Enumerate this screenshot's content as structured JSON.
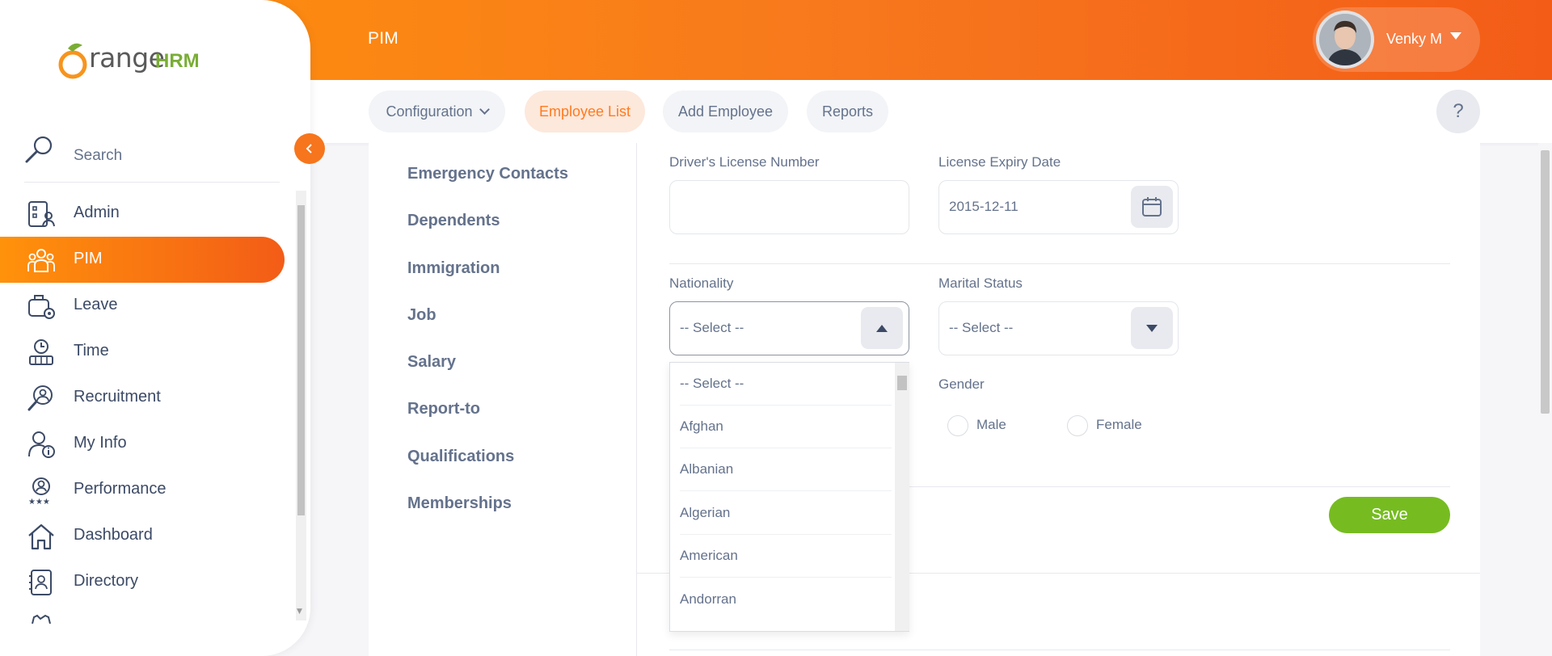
{
  "app": {
    "brand_text": "range",
    "brand_hrm": "HRM",
    "module_title": "PIM"
  },
  "user": {
    "name": "Venky M"
  },
  "subnav": {
    "configuration": "Configuration",
    "employee_list": "Employee List",
    "add_employee": "Add Employee",
    "reports": "Reports",
    "help": "?"
  },
  "sidebar": {
    "search_label": "Search",
    "items": [
      {
        "label": "Admin",
        "icon": "admin-icon"
      },
      {
        "label": "PIM",
        "icon": "pim-icon",
        "active": true
      },
      {
        "label": "Leave",
        "icon": "leave-icon"
      },
      {
        "label": "Time",
        "icon": "time-icon"
      },
      {
        "label": "Recruitment",
        "icon": "recruitment-icon"
      },
      {
        "label": "My Info",
        "icon": "my-info-icon"
      },
      {
        "label": "Performance",
        "icon": "performance-icon"
      },
      {
        "label": "Dashboard",
        "icon": "dashboard-icon"
      },
      {
        "label": "Directory",
        "icon": "directory-icon"
      }
    ]
  },
  "tabs": [
    "Emergency Contacts",
    "Dependents",
    "Immigration",
    "Job",
    "Salary",
    "Report-to",
    "Qualifications",
    "Memberships"
  ],
  "form": {
    "drivers_license_label": "Driver's License Number",
    "drivers_license_value": "",
    "license_expiry_label": "License Expiry Date",
    "license_expiry_value": "2015-12-11",
    "nationality_label": "Nationality",
    "nationality_value": "-- Select --",
    "marital_status_label": "Marital Status",
    "marital_status_value": "-- Select --",
    "gender_label": "Gender",
    "gender_male": "Male",
    "gender_female": "Female",
    "save": "Save"
  },
  "nationality_options": [
    "-- Select --",
    "Afghan",
    "Albanian",
    "Algerian",
    "American",
    "Andorran"
  ],
  "colors": {
    "accent": "#ff7b1d",
    "save": "#76bc21"
  }
}
